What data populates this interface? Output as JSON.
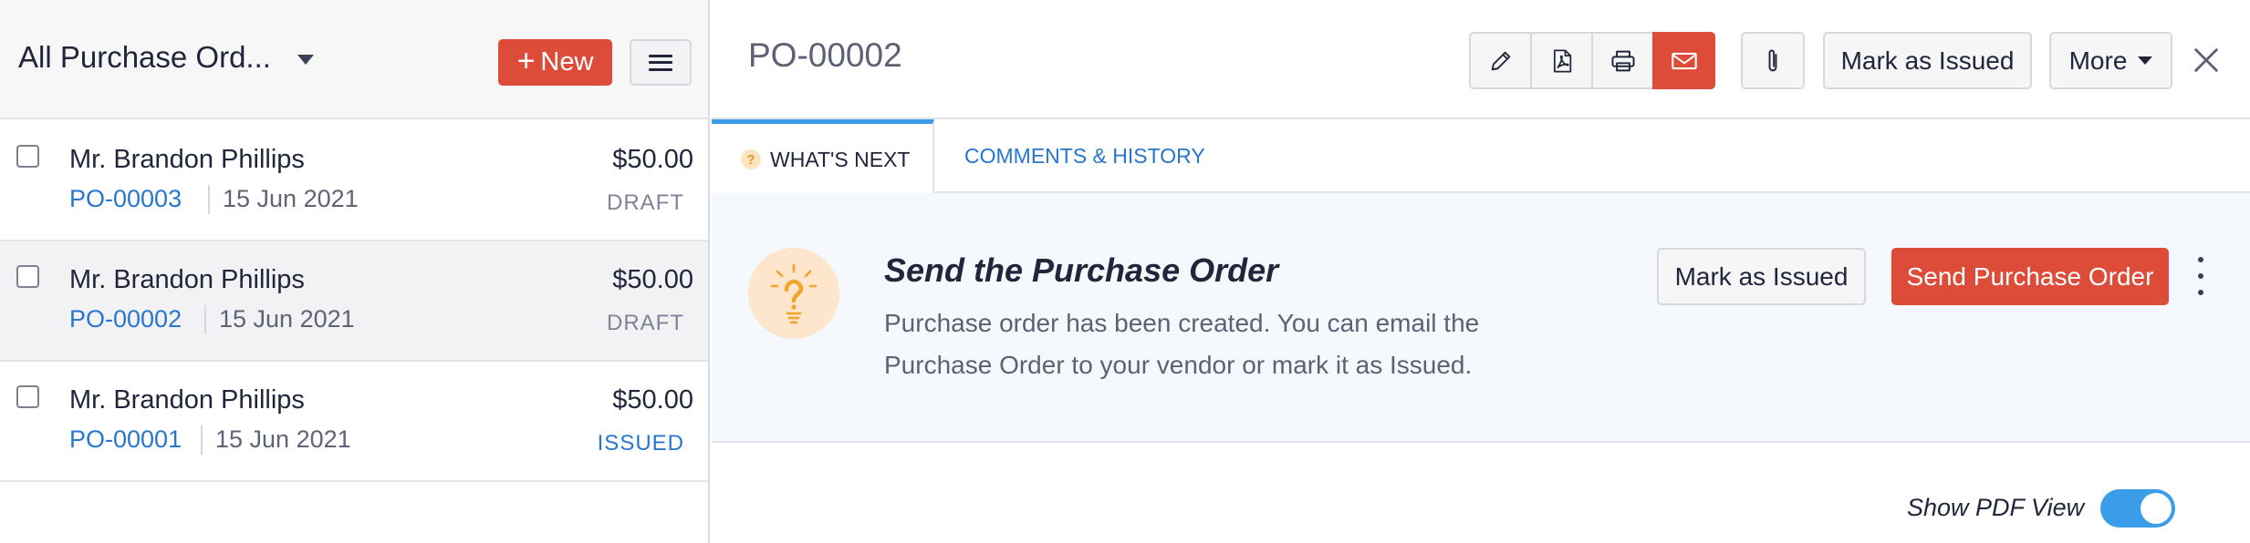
{
  "list": {
    "view_title": "All Purchase Ord...",
    "new_label": "New",
    "rows": [
      {
        "name": "Mr. Brandon Phillips",
        "po": "PO-00003",
        "date": "15 Jun 2021",
        "amount": "$50.00",
        "status": "DRAFT"
      },
      {
        "name": "Mr. Brandon Phillips",
        "po": "PO-00002",
        "date": "15 Jun 2021",
        "amount": "$50.00",
        "status": "DRAFT"
      },
      {
        "name": "Mr. Brandon Phillips",
        "po": "PO-00001",
        "date": "15 Jun 2021",
        "amount": "$50.00",
        "status": "ISSUED"
      }
    ]
  },
  "detail": {
    "title": "PO-00002",
    "mark_issued_label": "Mark as Issued",
    "more_label": "More",
    "icons": [
      "pencil-icon",
      "pdf-icon",
      "print-icon",
      "email-icon",
      "attachment-icon",
      "close-icon"
    ]
  },
  "tabs": [
    {
      "label": "WHAT'S NEXT",
      "badge": "?"
    },
    {
      "label": "COMMENTS & HISTORY"
    }
  ],
  "whats_next": {
    "title": "Send the Purchase Order",
    "description_line1": "Purchase order has been created. You can email the",
    "description_line2": "Purchase Order to your vendor or mark it as Issued.",
    "mark_issued_label": "Mark as Issued",
    "send_label": "Send Purchase Order"
  },
  "pdf_toggle": {
    "label": "Show PDF View",
    "on": true
  },
  "colors": {
    "accent_red": "#dd4b39",
    "link_blue": "#2776d0",
    "toggle_blue": "#3b9ce8",
    "bulb_bg": "#fde6cb"
  }
}
